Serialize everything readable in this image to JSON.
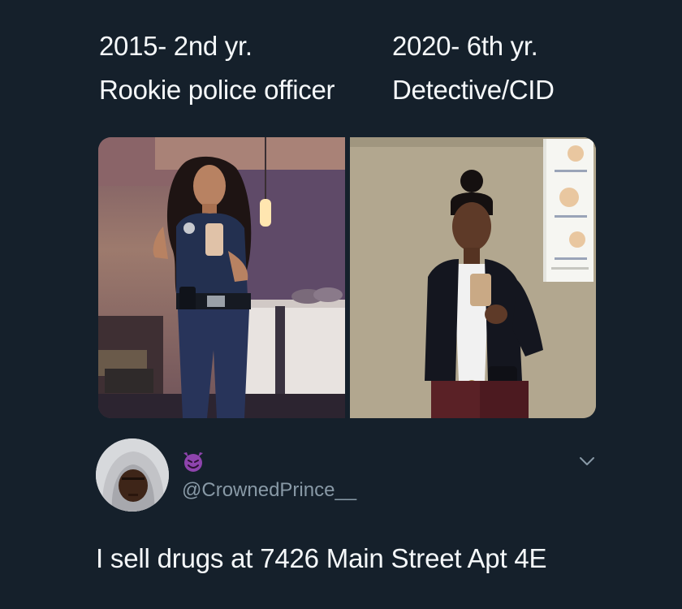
{
  "captions": {
    "left": {
      "line1": "2015- 2nd yr.",
      "line2": "Rookie police officer"
    },
    "right": {
      "line1": "2020- 6th yr.",
      "line2": "Detective/CID"
    }
  },
  "photos": [
    {
      "name": "photo-rookie-officer"
    },
    {
      "name": "photo-detective"
    }
  ],
  "author": {
    "display_name_emoji": "smiling-imp-emoji",
    "handle": "@CrownedPrince__",
    "avatar": "avatar"
  },
  "tweet": {
    "text": "I sell drugs at 7426 Main Street Apt 4E"
  },
  "menu_icon": "chevron-down-icon",
  "colors": {
    "background": "#15202b",
    "text": "#f5f8fa",
    "secondary_text": "#8899a6",
    "emoji_purple": "#8e44ad"
  }
}
